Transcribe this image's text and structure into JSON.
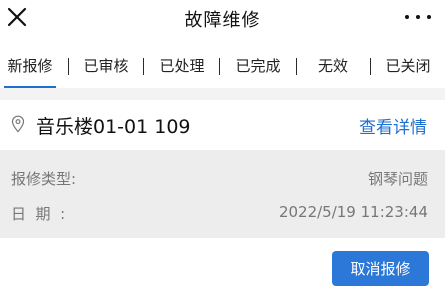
{
  "header": {
    "title": "故障维修",
    "close_icon": "close-icon",
    "more_icon": "more-icon"
  },
  "tabs": [
    {
      "label": "新报修",
      "active": true
    },
    {
      "label": "已审核",
      "active": false
    },
    {
      "label": "已处理",
      "active": false
    },
    {
      "label": "已完成",
      "active": false
    },
    {
      "label": "无效",
      "active": false
    },
    {
      "label": "已关闭",
      "active": false
    }
  ],
  "record": {
    "location_icon": "location-pin-icon",
    "location": "音乐楼01-01 109",
    "detail_link": "查看详情",
    "type_label": "报修类型:",
    "type_value": "钢琴问题",
    "date_label": "日  期  :",
    "date_value": "2022/5/19 11:23:44"
  },
  "actions": {
    "cancel_label": "取消报修"
  },
  "colors": {
    "accent": "#1e6fd0",
    "button": "#2b78d9",
    "info_background": "#ededed"
  }
}
